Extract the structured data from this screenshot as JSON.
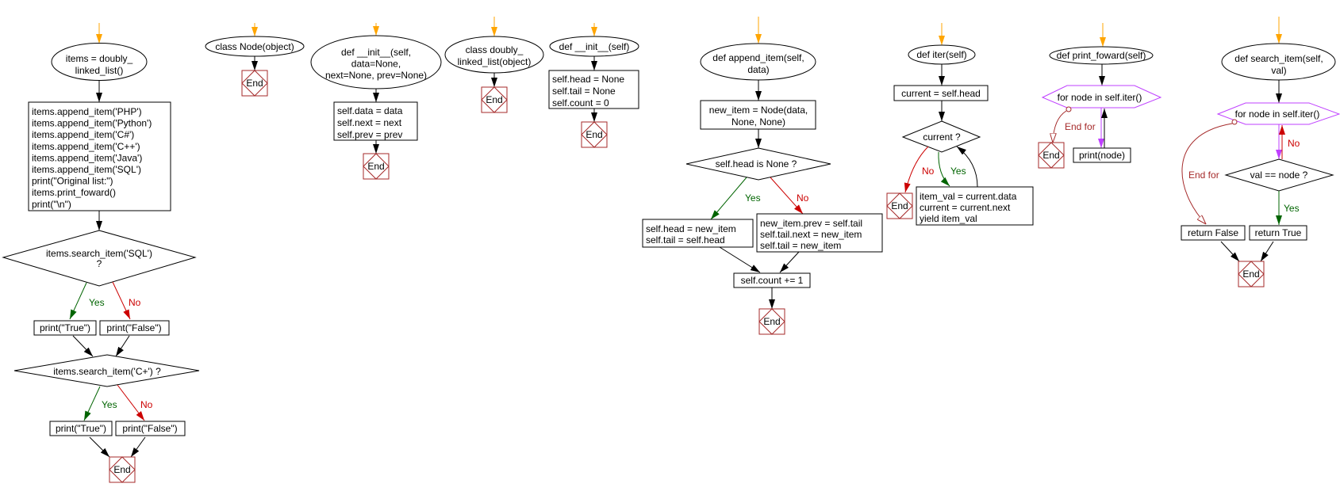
{
  "labels": {
    "end": "End",
    "yes": "Yes",
    "no": "No",
    "end_for": "End for"
  },
  "colors": {
    "start_arrow": "#FFA500",
    "end_node": "#A52A2A",
    "loop": "#BF40FF",
    "yes": "#006400",
    "no": "#CC0000",
    "end_for": "#A52A2A"
  },
  "main": {
    "start": [
      "items = doubly_",
      "linked_list()"
    ],
    "body": [
      "items.append_item('PHP')",
      "items.append_item('Python')",
      "items.append_item('C#')",
      "items.append_item('C++')",
      "items.append_item('Java')",
      "items.append_item('SQL')",
      "print(\"Original list:\")",
      "items.print_foward()",
      "print(\"\\n\")"
    ],
    "cond1": [
      "items.search_item('SQL')",
      "?"
    ],
    "true1": "print(\"True\")",
    "false1": "print(\"False\")",
    "cond2": "items.search_item('C+') ?",
    "true2": "print(\"True\")",
    "false2": "print(\"False\")"
  },
  "node_class": {
    "start": "class Node(object)"
  },
  "node_init": {
    "start": [
      "def __init__(self,",
      "data=None,",
      "next=None, prev=None)"
    ],
    "body": [
      "self.data = data",
      "self.next = next",
      "self.prev = prev"
    ]
  },
  "dll_class": {
    "start": [
      "class doubly_",
      "linked_list(object)"
    ]
  },
  "dll_init": {
    "start": "def __init__(self)",
    "body": [
      "self.head = None",
      "self.tail = None",
      "self.count = 0"
    ]
  },
  "append_item": {
    "start": [
      "def append_item(self,",
      "data)"
    ],
    "create": [
      "new_item = Node(data,",
      "None, None)"
    ],
    "cond": "self.head is None ?",
    "yes_body": [
      "self.head = new_item",
      "self.tail = self.head"
    ],
    "no_body": [
      "new_item.prev = self.tail",
      "self.tail.next = new_item",
      "self.tail = new_item"
    ],
    "count": "self.count += 1"
  },
  "iter": {
    "start": "def iter(self)",
    "init": "current = self.head",
    "cond": "current ?",
    "body": [
      "item_val = current.data",
      "current = current.next",
      "yield item_val"
    ]
  },
  "print_foward": {
    "start": "def print_foward(self)",
    "loop": "for node in self.iter()",
    "body": "print(node)"
  },
  "search_item": {
    "start": [
      "def search_item(self,",
      "val)"
    ],
    "loop": "for node in self.iter()",
    "cond": "val == node ?",
    "ret_false": "return False",
    "ret_true": "return True"
  }
}
